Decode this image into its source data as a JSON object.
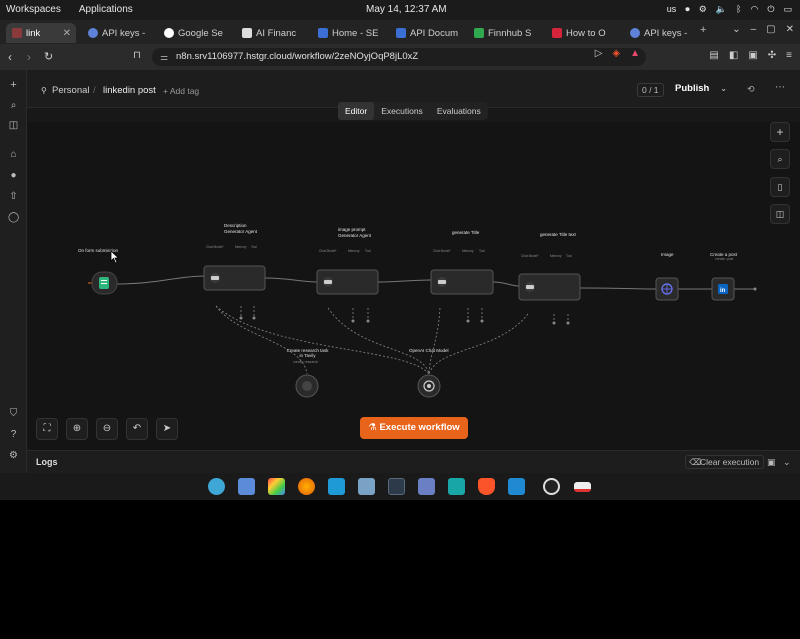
{
  "system_bar": {
    "left_items": [
      "Workspaces",
      "Applications"
    ],
    "clock": "May 14, 12:37 AM",
    "indicators": [
      "us",
      "record-icon",
      "settings-icon",
      "volume-icon",
      "bluetooth-icon",
      "wifi-icon",
      "power-icon",
      "battery-icon"
    ]
  },
  "browser": {
    "tabs": [
      {
        "title": "link",
        "active": true,
        "color": "#8a3a3a"
      },
      {
        "title": "API keys -",
        "active": false,
        "color": "#5e82d8"
      },
      {
        "title": "Google Se",
        "active": false,
        "color": "#e9e9e9"
      },
      {
        "title": "AI Financ",
        "active": false,
        "color": "#dddddd"
      },
      {
        "title": "Home - SE",
        "active": false,
        "color": "#3b6fd6"
      },
      {
        "title": "API Docum",
        "active": false,
        "color": "#3b6fd6"
      },
      {
        "title": "Finnhub S",
        "active": false,
        "color": "#2fa84f"
      },
      {
        "title": "How to O",
        "active": false,
        "color": "#d6243a"
      },
      {
        "title": "API keys -",
        "active": false,
        "color": "#5e82d8"
      }
    ],
    "url": "n8n.srv1106977.hstgr.cloud/workflow/2zeNOyjOqP8jL0xZ"
  },
  "app": {
    "breadcrumb": {
      "owner": "Personal",
      "workflow": "linkedin post",
      "add_tag": "+ Add tag"
    },
    "counter": "0 / 1",
    "publish_label": "Publish",
    "mode_tabs": [
      "Editor",
      "Executions",
      "Evaluations"
    ],
    "active_mode": "Editor",
    "execute_label": "Execute workflow",
    "logs_label": "Logs",
    "clear_execution": "Clear execution"
  },
  "workflow": {
    "trigger": {
      "name": "On form submission"
    },
    "nodes": [
      {
        "name": "Description Generator Agent",
        "ports": [
          "Chat Model*",
          "Memory",
          "Tool"
        ]
      },
      {
        "name": "image prompt Generator Agent",
        "ports": [
          "Chat Model*",
          "Memory",
          "Tool"
        ]
      },
      {
        "name": "generate Title",
        "ports": [
          "Chat Model*",
          "Memory",
          "Tool"
        ]
      },
      {
        "name": "generate Title text",
        "ports": [
          "Chat Model*",
          "Memory",
          "Tool"
        ]
      },
      {
        "name": "Image",
        "sub": ""
      },
      {
        "name": "Create a post",
        "sub": "create: post"
      }
    ],
    "sub_nodes": [
      {
        "name": "Create research task in Tavily",
        "sub": "create: research"
      },
      {
        "name": "OpenAI Chat Model",
        "sub": ""
      }
    ]
  },
  "colors": {
    "accent": "#e8641b",
    "trigger_icon": "#2fb67c",
    "http_icon": "#6b77ff",
    "linkedin": "#0a66c2"
  }
}
